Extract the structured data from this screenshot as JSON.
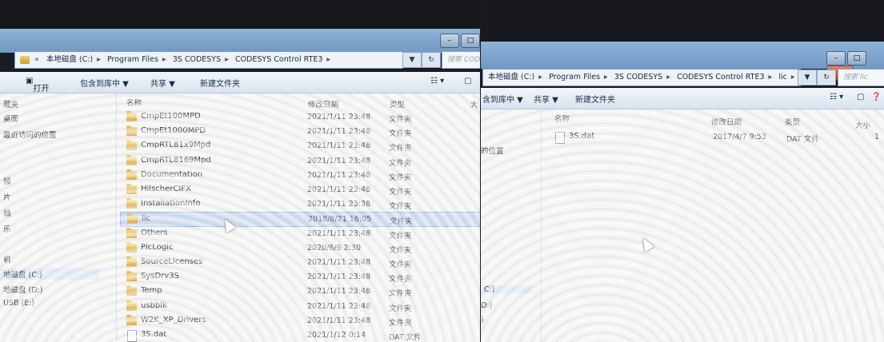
{
  "left_window": {
    "address": {
      "prefix": "«",
      "segments": [
        "本地磁盘 (C:)",
        "Program Files",
        "3S CODESYS",
        "CODESYS Control RTE3"
      ],
      "search_placeholder": "搜索 COD"
    },
    "toolbar": {
      "open": "打开",
      "include": "包含到库中 ▼",
      "share": "共享 ▼",
      "new_folder": "新建文件夹"
    },
    "nav": [
      "藏夹",
      "桌面",
      "最近访问的位置",
      "",
      "频",
      "片",
      "档",
      "乐",
      "",
      "机",
      "地磁盘 (C:)",
      "地磁盘 (D:)",
      "USB (E:)"
    ],
    "columns": {
      "name": "名称",
      "date": "修改日期",
      "type": "类型",
      "size": "大"
    },
    "rows": [
      {
        "name": "CmpEt100MPD",
        "date": "2021/1/11 23:48",
        "type": "文件夹",
        "kind": "folder"
      },
      {
        "name": "CmpEt1000MPD",
        "date": "2021/1/11 23:48",
        "type": "文件夹",
        "kind": "folder"
      },
      {
        "name": "CmpRTL81x9Mpd",
        "date": "2021/1/11 23:48",
        "type": "文件夹",
        "kind": "folder"
      },
      {
        "name": "CmpRTL8169Mpd",
        "date": "2021/1/11 23:48",
        "type": "文件夹",
        "kind": "folder"
      },
      {
        "name": "Documentation",
        "date": "2021/1/11 23:48",
        "type": "文件夹",
        "kind": "folder"
      },
      {
        "name": "HilscherCIFX",
        "date": "2021/1/11 23:48",
        "type": "文件夹",
        "kind": "folder"
      },
      {
        "name": "InstallationInfo",
        "date": "2021/1/11 23:38",
        "type": "文件夹",
        "kind": "folder"
      },
      {
        "name": "lic",
        "date": "2018/8/21 16:05",
        "type": "文件夹",
        "kind": "folder",
        "selected": true
      },
      {
        "name": "Others",
        "date": "2021/1/11 23:48",
        "type": "文件夹",
        "kind": "folder"
      },
      {
        "name": "PlcLogic",
        "date": "2020/6/9 2:30",
        "type": "文件夹",
        "kind": "folder"
      },
      {
        "name": "SourceLicenses",
        "date": "2021/1/11 23:48",
        "type": "文件夹",
        "kind": "folder"
      },
      {
        "name": "SysDrv3S",
        "date": "2021/1/11 23:48",
        "type": "文件夹",
        "kind": "folder"
      },
      {
        "name": "Temp",
        "date": "2021/1/11 23:48",
        "type": "文件夹",
        "kind": "folder"
      },
      {
        "name": "usbblk",
        "date": "2021/1/11 23:48",
        "type": "文件夹",
        "kind": "folder"
      },
      {
        "name": "W2K_XP_Drivers",
        "date": "2021/1/11 23:48",
        "type": "文件夹",
        "kind": "folder"
      },
      {
        "name": "3S.dat",
        "date": "2021/1/12 0:14",
        "type": "DAT 文件",
        "kind": "file"
      }
    ]
  },
  "right_window": {
    "address": {
      "segments": [
        "本地磁盘 (C:)",
        "Program Files",
        "3S CODESYS",
        "CODESYS Control RTE3",
        "lic"
      ],
      "search_placeholder": "搜索 lic"
    },
    "toolbar": {
      "include": "含到库中 ▼",
      "share": "共享 ▼",
      "new_folder": "新建文件夹"
    },
    "nav": [
      "的位置",
      "",
      "",
      "",
      "",
      "C:)",
      "D:)",
      ")"
    ],
    "columns": {
      "name": "名称",
      "date": "修改日期",
      "type": "类型",
      "size": "大小"
    },
    "rows": [
      {
        "name": "3S.dat",
        "date": "2017/4/7 9:53",
        "type": "DAT 文件",
        "size": "1"
      }
    ]
  },
  "colors": {
    "accent": "#6f98c4",
    "selection": "#a8c4e6",
    "background": "#f3f3f1"
  }
}
